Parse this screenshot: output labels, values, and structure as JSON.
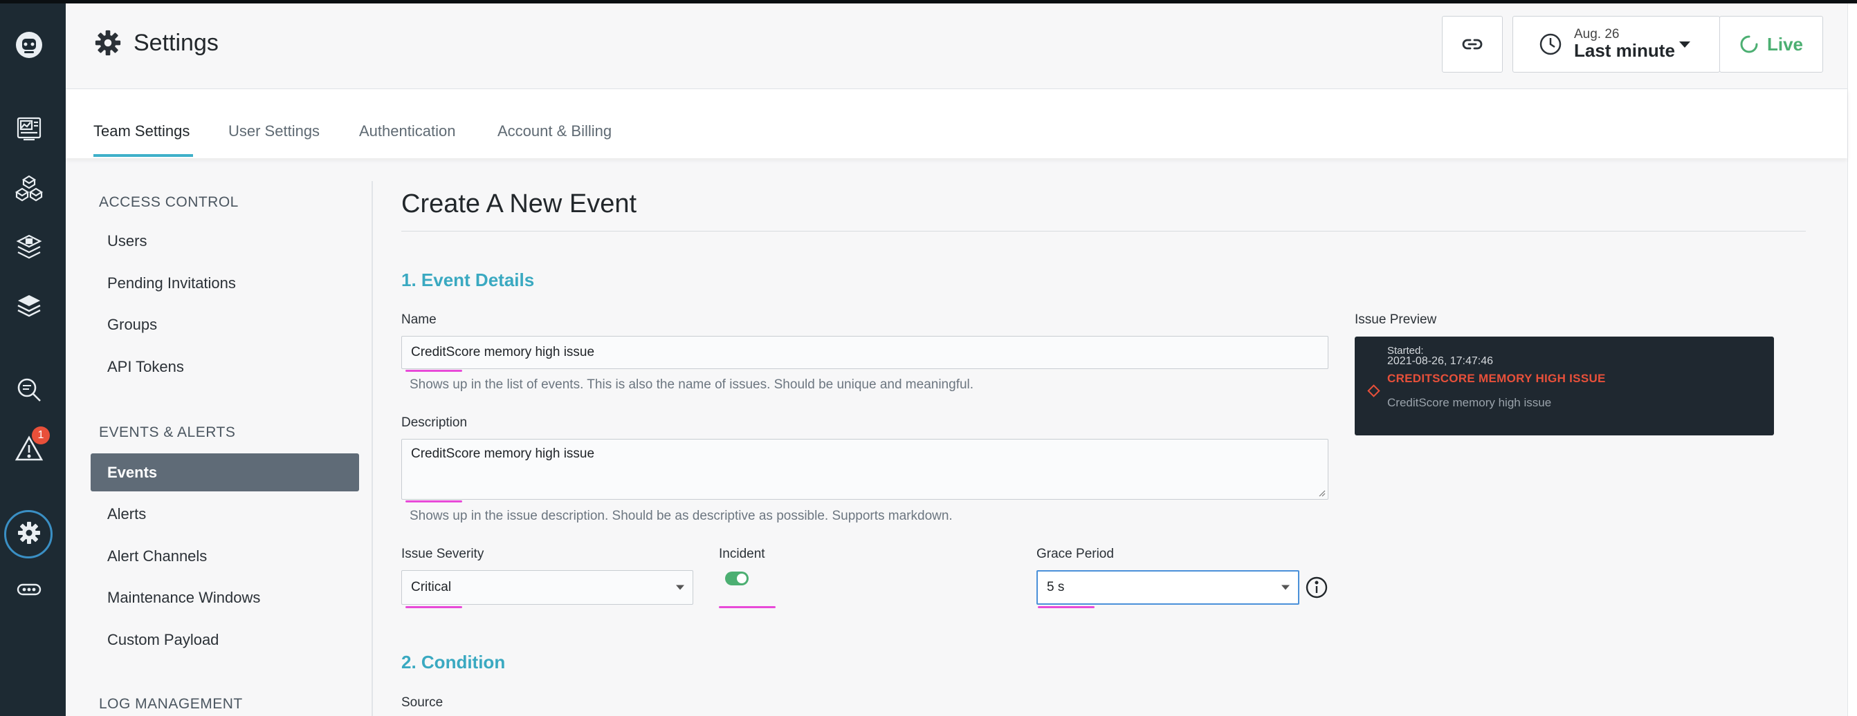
{
  "header": {
    "title": "Settings",
    "time_date": "Aug. 26",
    "time_range": "Last minute",
    "live_label": "Live"
  },
  "tabs": [
    {
      "label": "Team Settings",
      "active": true
    },
    {
      "label": "User Settings",
      "active": false
    },
    {
      "label": "Authentication",
      "active": false
    },
    {
      "label": "Account & Billing",
      "active": false
    }
  ],
  "rail": {
    "alert_count": "1"
  },
  "sidebar": {
    "access_control_heading": "ACCESS CONTROL",
    "access_items": [
      "Users",
      "Pending Invitations",
      "Groups",
      "API Tokens"
    ],
    "events_heading": "EVENTS & ALERTS",
    "events_items": [
      "Events",
      "Alerts",
      "Alert Channels",
      "Maintenance Windows",
      "Custom Payload"
    ],
    "log_heading": "LOG MANAGEMENT"
  },
  "main": {
    "title": "Create A New Event",
    "section1": "1. Event Details",
    "name_label": "Name",
    "name_value": "CreditScore memory high issue",
    "name_help": "Shows up in the list of events. This is also the name of issues. Should be unique and meaningful.",
    "description_label": "Description",
    "description_value": "CreditScore memory high issue",
    "description_help": "Shows up in the issue description. Should be as descriptive as possible. Supports markdown.",
    "severity_label": "Issue Severity",
    "severity_value": "Critical",
    "incident_label": "Incident",
    "grace_label": "Grace Period",
    "grace_value": "5 s",
    "section2": "2. Condition",
    "source_label": "Source"
  },
  "preview": {
    "label": "Issue Preview",
    "started_label": "Started:",
    "started_value": "2021-08-26, 17:47:46",
    "title": "CREDITSCORE MEMORY HIGH ISSUE",
    "subtitle": "CreditScore memory high issue"
  },
  "colors": {
    "accent": "#3fb0c9",
    "live_green": "#4caf72",
    "alert_red": "#e8503a",
    "rail_bg": "#1d2a33"
  }
}
